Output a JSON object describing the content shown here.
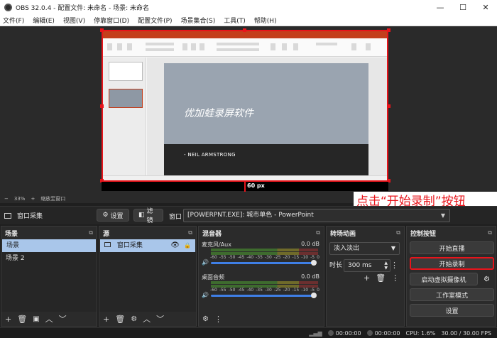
{
  "window": {
    "title": "OBS 32.0.4 - 配置文件: 未命名 - 场景: 未命名",
    "minimize": "—",
    "maximize": "☐",
    "close": "✕"
  },
  "menu": [
    "文件(F)",
    "编辑(E)",
    "视图(V)",
    "停靠窗口(D)",
    "配置文件(P)",
    "场景集合(S)",
    "工具(T)",
    "帮助(H)"
  ],
  "preview": {
    "slide_text": "优加蛙录屏软件",
    "slide_author": "- NEIL ARMSTRONG",
    "px_label": "60 px",
    "zoom_text": "33%",
    "zoom_label": "缩放至窗口"
  },
  "annotation": "点击“开始录制”按钮",
  "source_toolbar": {
    "source_name": "窗口采集",
    "properties_label": "设置",
    "filters_label": "滤镜",
    "window_label": "窗口",
    "window_value": "[POWERPNT.EXE]: 城市单色 - PowerPoint"
  },
  "scenes": {
    "title": "场景",
    "items": [
      "场景",
      "场景 2"
    ]
  },
  "sources": {
    "title": "源",
    "items": [
      "窗口采集"
    ]
  },
  "mixer": {
    "title": "混音器",
    "channels": [
      {
        "name": "麦克风/Aux",
        "db": "0.0 dB",
        "level": 0.0
      },
      {
        "name": "桌面音频",
        "db": "0.0 dB",
        "level": 0.0
      }
    ],
    "ticks": [
      "-60",
      "-55",
      "-50",
      "-45",
      "-40",
      "-35",
      "-30",
      "-25",
      "-20",
      "-15",
      "-10",
      "-5",
      "0"
    ]
  },
  "transitions": {
    "title": "转场动画",
    "selected": "淡入淡出",
    "duration_label": "时长",
    "duration_value": "300 ms"
  },
  "controls": {
    "title": "控制按钮",
    "start_streaming": "开始直播",
    "start_recording": "开始录制",
    "virtual_camera": "启动虚拟摄像机",
    "studio_mode": "工作室模式",
    "settings": "设置"
  },
  "status": {
    "stream_time": "00:00:00",
    "record_time": "00:00:00",
    "cpu": "CPU: 1.6%",
    "fps": "30.00 / 30.00 FPS"
  },
  "colors": {
    "highlight_red": "#e8141b",
    "selected_row": "#a9c6ea",
    "slider_blue": "#3f7fe6"
  }
}
